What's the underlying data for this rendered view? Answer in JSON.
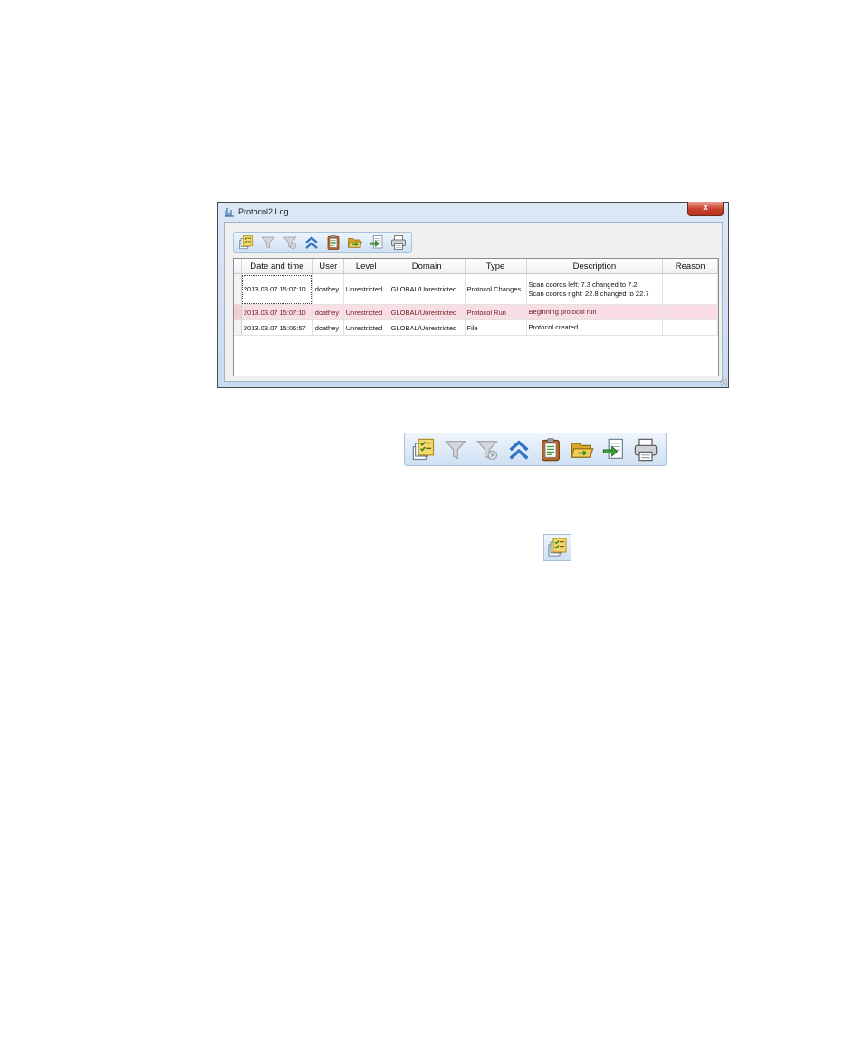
{
  "window": {
    "title": "Protocol2 Log",
    "close_label": "x"
  },
  "toolbar": {
    "buttons": [
      {
        "name": "show-log-button",
        "icon": "log-checklist-icon"
      },
      {
        "name": "filter-button",
        "icon": "filter-icon"
      },
      {
        "name": "clear-filter-button",
        "icon": "filter-clear-icon"
      },
      {
        "name": "collapse-button",
        "icon": "chevron-double-up-icon"
      },
      {
        "name": "archive-button",
        "icon": "clipboard-icon"
      },
      {
        "name": "open-folder-button",
        "icon": "folder-open-icon"
      },
      {
        "name": "export-button",
        "icon": "export-icon"
      },
      {
        "name": "print-button",
        "icon": "printer-icon"
      }
    ]
  },
  "table": {
    "columns": [
      "Date and time",
      "User",
      "Level",
      "Domain",
      "Type",
      "Description",
      "Reason"
    ],
    "rows": [
      {
        "date": "2013.03.07 15:07:10",
        "user": "dcathey",
        "level": "Unrestricted",
        "domain": "GLOBAL/Unrestricted",
        "type": "Protocol Changes",
        "description": [
          "Scan coords left: 7.3 changed to 7.2",
          "Scan coords right: 22.8 changed to 22.7"
        ],
        "reason": ""
      },
      {
        "date": "2013.03.07 15:07:10",
        "user": "dcathey",
        "level": "Unrestricted",
        "domain": "GLOBAL/Unrestricted",
        "type": "Protocol Run",
        "description": [
          "Beginning protocol run"
        ],
        "reason": ""
      },
      {
        "date": "2013.03.07 15:06:57",
        "user": "dcathey",
        "level": "Unrestricted",
        "domain": "GLOBAL/Unrestricted",
        "type": "File",
        "description": [
          "Protocol created"
        ],
        "reason": ""
      }
    ]
  },
  "colors": {
    "highlight_row": "#f9dfe5",
    "titlebar": "#dbe8f6",
    "close_button": "#c7402b"
  }
}
